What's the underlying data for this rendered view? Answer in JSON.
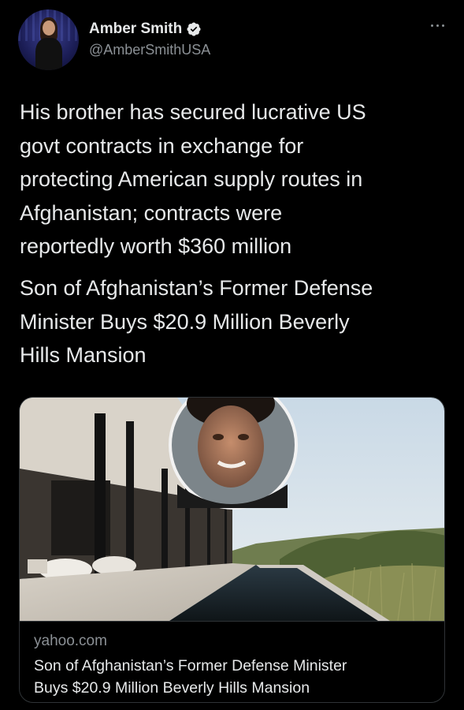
{
  "tweet": {
    "author": {
      "display_name": "Amber Smith",
      "handle": "@AmberSmithUSA",
      "verified": true
    },
    "menu_icon": "more-horizontal-icon",
    "text_paragraph_1": "His brother has secured lucrative US\ngovt contracts in exchange for\nprotecting American supply routes in\nAfghanistan; contracts were\nreportedly worth $360 million",
    "text_paragraph_2": "Son of Afghanistan’s Former Defense\nMinister Buys $20.9 Million Beverly\nHills Mansion"
  },
  "link_card": {
    "domain": "yahoo.com",
    "title": "Son of Afghanistan’s Former Defense Minister\nBuys $20.9 Million Beverly Hills Mansion"
  },
  "colors": {
    "background": "#000000",
    "text_primary": "#e7e9ea",
    "text_secondary": "#8b9095",
    "verified_badge": "#e7e9ea",
    "card_border": "#2f3336"
  }
}
